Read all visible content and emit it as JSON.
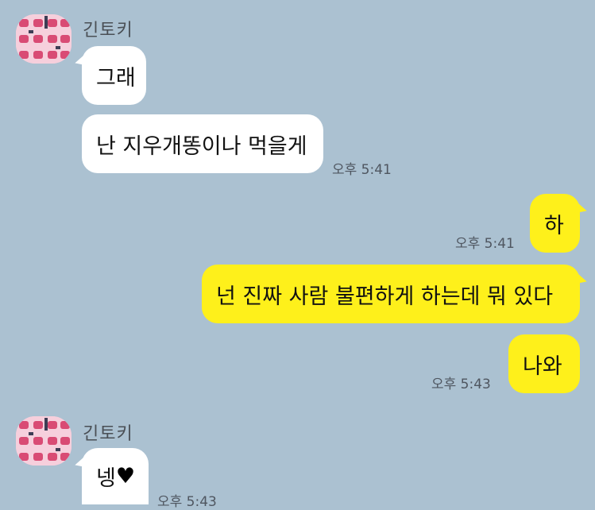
{
  "chat": {
    "background_color": "#abc1d1",
    "incoming_bubble_color": "#ffffff",
    "outgoing_bubble_color": "#fef01b",
    "groups": [
      {
        "sender": "긴토키",
        "messages": [
          "그래",
          "난 지우개똥이나 먹을게"
        ],
        "time": "오후 5:41"
      },
      {
        "outgoing": true,
        "messages": [
          "하"
        ],
        "time": "오후 5:41"
      },
      {
        "outgoing": true,
        "messages": [
          "넌 진짜 사람 불편하게 하는데 뭐 있다",
          "나와"
        ],
        "time": "오후 5:43"
      },
      {
        "sender": "긴토키",
        "messages": [
          "넹",
          "♥"
        ],
        "time": "오후 5:43"
      }
    ]
  }
}
